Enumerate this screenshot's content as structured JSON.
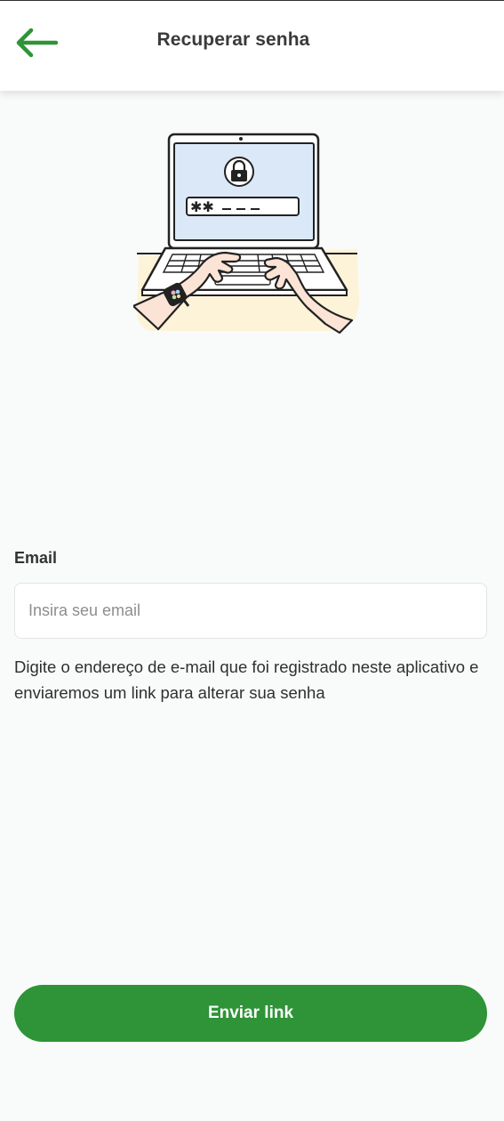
{
  "header": {
    "title": "Recuperar senha",
    "back_icon": "arrow-left-icon"
  },
  "illustration": {
    "name": "laptop-password-illustration",
    "icons": [
      "padlock-icon",
      "password-field-icon",
      "hands-typing-icon",
      "smartwatch-icon"
    ]
  },
  "form": {
    "email_label": "Email",
    "email_value": "",
    "email_placeholder": "Insira seu email",
    "help_text": "Digite o endereço de e-mail que foi registrado neste aplicativo e enviaremos um link para alterar sua senha"
  },
  "actions": {
    "send_label": "Enviar link"
  },
  "colors": {
    "accent": "#2e9437",
    "background": "#f9fbfa",
    "header_background": "#ffffff",
    "text": "#2f2f2f",
    "placeholder": "#8e8e8e",
    "laptop_screen": "#dbe8f8",
    "desk": "#fdf3d8",
    "skin": "#fbe3d6"
  }
}
